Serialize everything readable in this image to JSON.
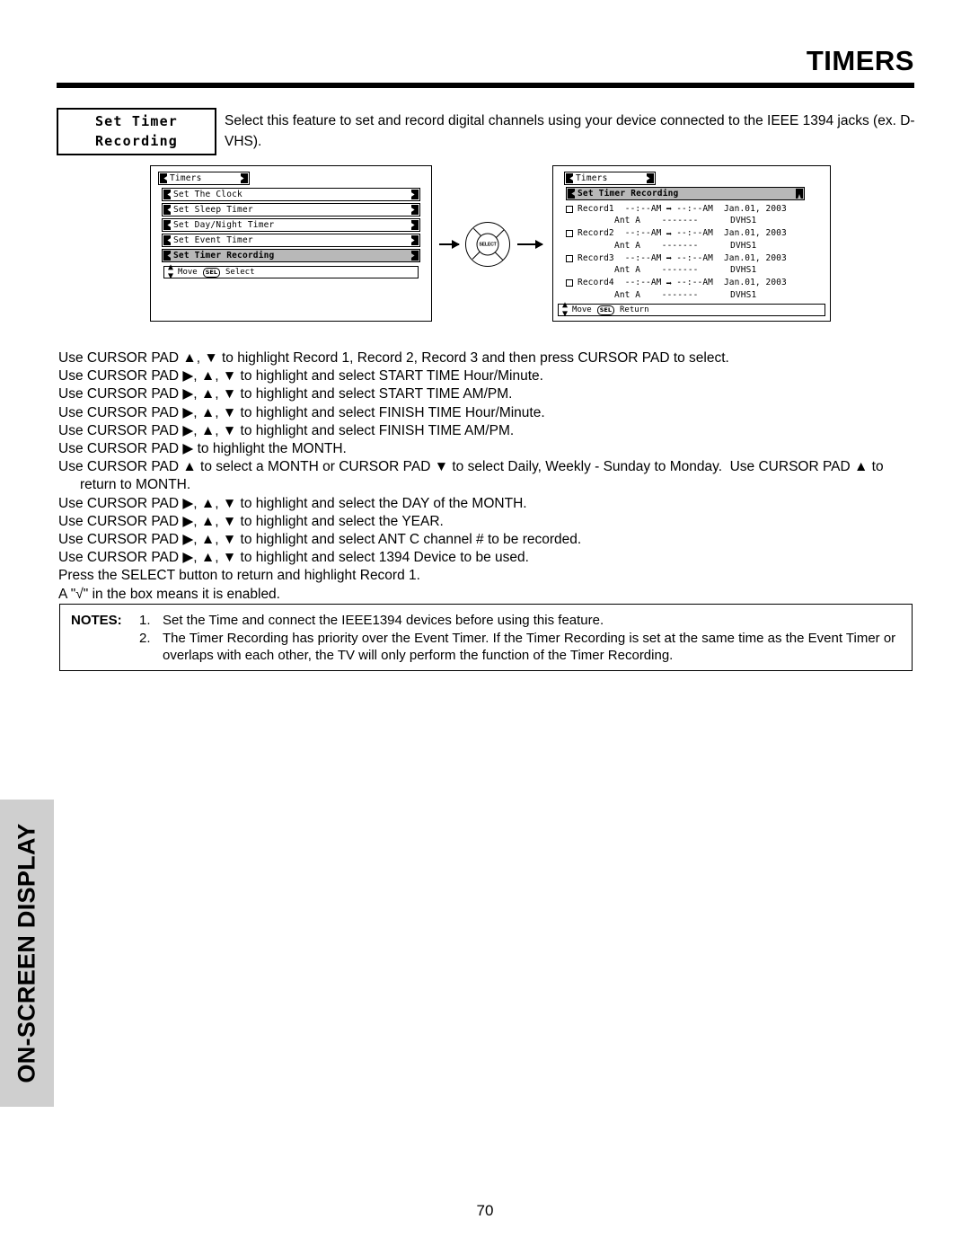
{
  "header": {
    "title": "TIMERS"
  },
  "feature": {
    "label_line1": "Set Timer",
    "label_line2": "Recording",
    "description": "Select this feature to set and record digital channels using your device connected to the IEEE 1394 jacks (ex. D-VHS)."
  },
  "osd_left": {
    "title": "Timers",
    "items": [
      "Set The Clock",
      "Set Sleep Timer",
      "Set Day/Night Timer",
      "Set Event Timer",
      "Set Timer Recording"
    ],
    "selected_index": 4,
    "help_move": "Move",
    "help_key": "SEL",
    "help_action": "Select"
  },
  "cursor_pad": {
    "center_label": "SELECT"
  },
  "osd_right": {
    "title": "Timers",
    "subtitle": "Set Timer Recording",
    "records": [
      {
        "name": "Record1",
        "start_time": "--:--AM",
        "finish_time": "--:--AM",
        "date": "Jan.01, 2003",
        "antenna": "Ant A",
        "channel": "-------",
        "device": "DVHS1",
        "enabled": false
      },
      {
        "name": "Record2",
        "start_time": "--:--AM",
        "finish_time": "--:--AM",
        "date": "Jan.01, 2003",
        "antenna": "Ant A",
        "channel": "-------",
        "device": "DVHS1",
        "enabled": false
      },
      {
        "name": "Record3",
        "start_time": "--:--AM",
        "finish_time": "--:--AM",
        "date": "Jan.01, 2003",
        "antenna": "Ant A",
        "channel": "-------",
        "device": "DVHS1",
        "enabled": false
      },
      {
        "name": "Record4",
        "start_time": "--:--AM",
        "finish_time": "--:--AM",
        "date": "Jan.01, 2003",
        "antenna": "Ant A",
        "channel": "-------",
        "device": "DVHS1",
        "enabled": false
      }
    ],
    "help_move": "Move",
    "help_key": "SEL",
    "help_action": "Return"
  },
  "instructions": [
    "Use CURSOR PAD ▲, ▼ to highlight Record 1, Record 2, Record 3 and then press CURSOR PAD to select.",
    "Use CURSOR PAD ▶, ▲, ▼ to highlight and select START TIME Hour/Minute.",
    "Use CURSOR PAD ▶, ▲, ▼ to highlight and select START TIME AM/PM.",
    "Use CURSOR PAD ▶, ▲, ▼ to highlight and select FINISH TIME Hour/Minute.",
    "Use CURSOR PAD ▶, ▲, ▼ to highlight and select FINISH TIME AM/PM.",
    "Use CURSOR PAD ▶ to highlight the MONTH.",
    "Use CURSOR PAD ▲ to select a MONTH or CURSOR PAD ▼ to select Daily, Weekly - Sunday to Monday.  Use CURSOR PAD ▲ to",
    "return to MONTH.",
    "Use CURSOR PAD ▶, ▲, ▼ to highlight and select the DAY of the MONTH.",
    "Use CURSOR PAD ▶, ▲, ▼ to highlight and select the YEAR.",
    "Use CURSOR PAD ▶, ▲, ▼ to highlight and select ANT C channel # to be recorded.",
    "Use CURSOR PAD ▶, ▲, ▼ to highlight and select 1394 Device to be used.",
    "Press the SELECT button to return and highlight Record 1.",
    "A \"√\" in the box means it is enabled."
  ],
  "notes": {
    "label": "NOTES:",
    "items": [
      {
        "num": "1.",
        "text": "Set the Time and connect the IEEE1394 devices before using this feature."
      },
      {
        "num": "2.",
        "text": "The Timer Recording has priority over the Event Timer.  If the Timer Recording is set at the same time as the Event Timer or overlaps with each other, the TV will only perform the function of the Timer Recording."
      }
    ]
  },
  "side_tab": {
    "label": "ON-SCREEN DISPLAY",
    "color": "#cfcfcf"
  },
  "footer": {
    "page_number": "70"
  }
}
